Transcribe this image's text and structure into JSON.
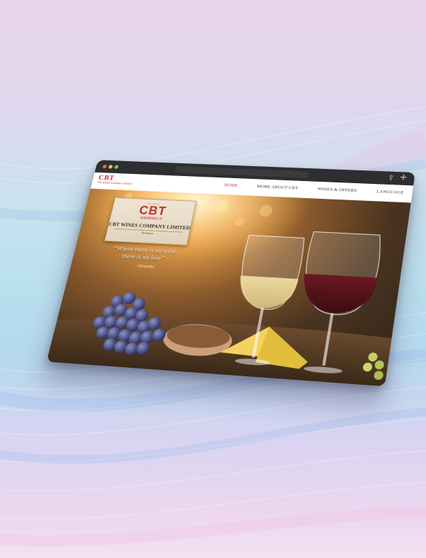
{
  "browser": {
    "share_icon": "share-icon",
    "new_tab_icon": "plus-icon"
  },
  "site": {
    "logo_text": "CBT",
    "logo_subtext": "CBT WINES COMPANY LIMITED",
    "nav": [
      {
        "label": "HOME",
        "active": true
      },
      {
        "label": "MORE ABOUT CBT",
        "active": false
      },
      {
        "label": "WINES & OFFERS",
        "active": false
      },
      {
        "label": "LANGUAGE",
        "active": false
      }
    ]
  },
  "hero": {
    "badge_top": "WINES",
    "badge_logo": "CBT",
    "badge_chinese": "香港酒業有限公司",
    "company_name": "CBT WINES COMPANY LIMITED",
    "badge_city": "Bordeaux",
    "quote_line1": "“Where there is no wine,",
    "quote_line2": "there is no love”",
    "quote_author": "- Euripides"
  },
  "colors": {
    "brand_red": "#c4302b",
    "gold": "#c9a55c"
  }
}
